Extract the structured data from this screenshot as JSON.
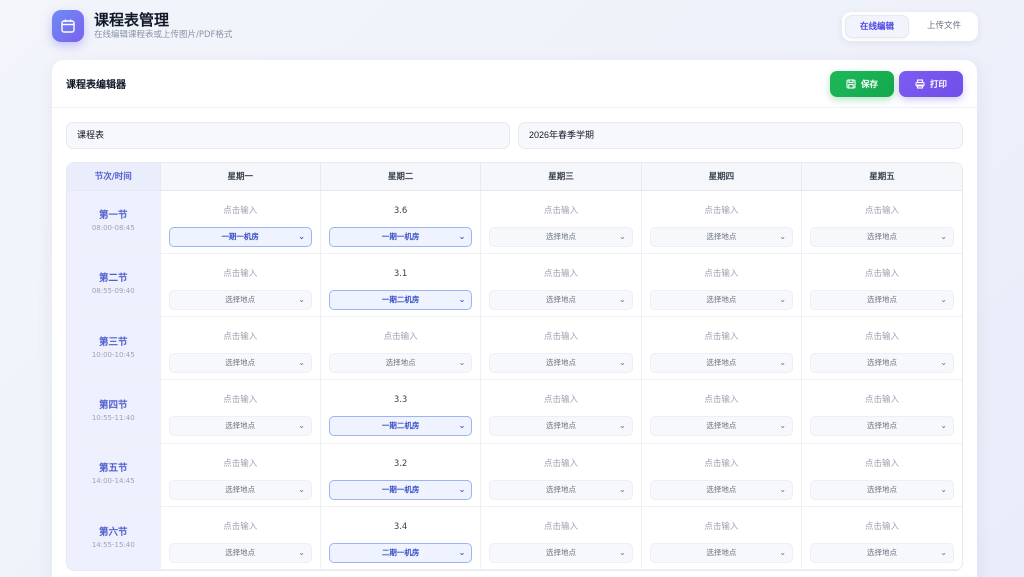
{
  "header": {
    "title": "课程表管理",
    "subtitle": "在线编辑课程表或上传图片/PDF格式",
    "icon": "calendar-icon",
    "tabs": [
      {
        "label": "在线编辑",
        "active": true
      },
      {
        "label": "上传文件",
        "active": false
      }
    ]
  },
  "editor": {
    "title": "课程表编辑器",
    "save_label": "保存",
    "print_label": "打印",
    "name_value": "课程表",
    "term_value": "2026年春季学期",
    "corner_label": "节次/时间",
    "days": [
      "星期一",
      "星期二",
      "星期三",
      "星期四",
      "星期五"
    ],
    "periods": [
      {
        "name": "第一节",
        "time": "08:00-08:45"
      },
      {
        "name": "第二节",
        "time": "08:55-09:40"
      },
      {
        "name": "第三节",
        "time": "10:00-10:45"
      },
      {
        "name": "第四节",
        "time": "10:55-11:40"
      },
      {
        "name": "第五节",
        "time": "14:00-14:45"
      },
      {
        "name": "第六节",
        "time": "14:55-15:40"
      }
    ],
    "cells": [
      [
        {
          "course": "点击输入",
          "loc": "一期一机房",
          "filled": false,
          "sel": true
        },
        {
          "course": "3.6",
          "loc": "一期一机房",
          "filled": true,
          "sel": true
        },
        {
          "course": "点击输入",
          "loc": "选择地点",
          "filled": false,
          "sel": false
        },
        {
          "course": "点击输入",
          "loc": "选择地点",
          "filled": false,
          "sel": false
        },
        {
          "course": "点击输入",
          "loc": "选择地点",
          "filled": false,
          "sel": false
        }
      ],
      [
        {
          "course": "点击输入",
          "loc": "选择地点",
          "filled": false,
          "sel": false
        },
        {
          "course": "3.1",
          "loc": "一期二机房",
          "filled": true,
          "sel": true
        },
        {
          "course": "点击输入",
          "loc": "选择地点",
          "filled": false,
          "sel": false
        },
        {
          "course": "点击输入",
          "loc": "选择地点",
          "filled": false,
          "sel": false
        },
        {
          "course": "点击输入",
          "loc": "选择地点",
          "filled": false,
          "sel": false
        }
      ],
      [
        {
          "course": "点击输入",
          "loc": "选择地点",
          "filled": false,
          "sel": false
        },
        {
          "course": "点击输入",
          "loc": "选择地点",
          "filled": false,
          "sel": false
        },
        {
          "course": "点击输入",
          "loc": "选择地点",
          "filled": false,
          "sel": false
        },
        {
          "course": "点击输入",
          "loc": "选择地点",
          "filled": false,
          "sel": false
        },
        {
          "course": "点击输入",
          "loc": "选择地点",
          "filled": false,
          "sel": false
        }
      ],
      [
        {
          "course": "点击输入",
          "loc": "选择地点",
          "filled": false,
          "sel": false
        },
        {
          "course": "3.3",
          "loc": "一期二机房",
          "filled": true,
          "sel": true
        },
        {
          "course": "点击输入",
          "loc": "选择地点",
          "filled": false,
          "sel": false
        },
        {
          "course": "点击输入",
          "loc": "选择地点",
          "filled": false,
          "sel": false
        },
        {
          "course": "点击输入",
          "loc": "选择地点",
          "filled": false,
          "sel": false
        }
      ],
      [
        {
          "course": "点击输入",
          "loc": "选择地点",
          "filled": false,
          "sel": false
        },
        {
          "course": "3.2",
          "loc": "一期一机房",
          "filled": true,
          "sel": true
        },
        {
          "course": "点击输入",
          "loc": "选择地点",
          "filled": false,
          "sel": false
        },
        {
          "course": "点击输入",
          "loc": "选择地点",
          "filled": false,
          "sel": false
        },
        {
          "course": "点击输入",
          "loc": "选择地点",
          "filled": false,
          "sel": false
        }
      ],
      [
        {
          "course": "点击输入",
          "loc": "选择地点",
          "filled": false,
          "sel": false
        },
        {
          "course": "3.4",
          "loc": "二期一机房",
          "filled": true,
          "sel": true
        },
        {
          "course": "点击输入",
          "loc": "选择地点",
          "filled": false,
          "sel": false
        },
        {
          "course": "点击输入",
          "loc": "选择地点",
          "filled": false,
          "sel": false
        },
        {
          "course": "点击输入",
          "loc": "选择地点",
          "filled": false,
          "sel": false
        }
      ]
    ]
  },
  "colors": {
    "accent": "#4f46e5",
    "save": "#1eb85a",
    "print": "#7c5cf0",
    "period_bg": "#eef1fd"
  }
}
